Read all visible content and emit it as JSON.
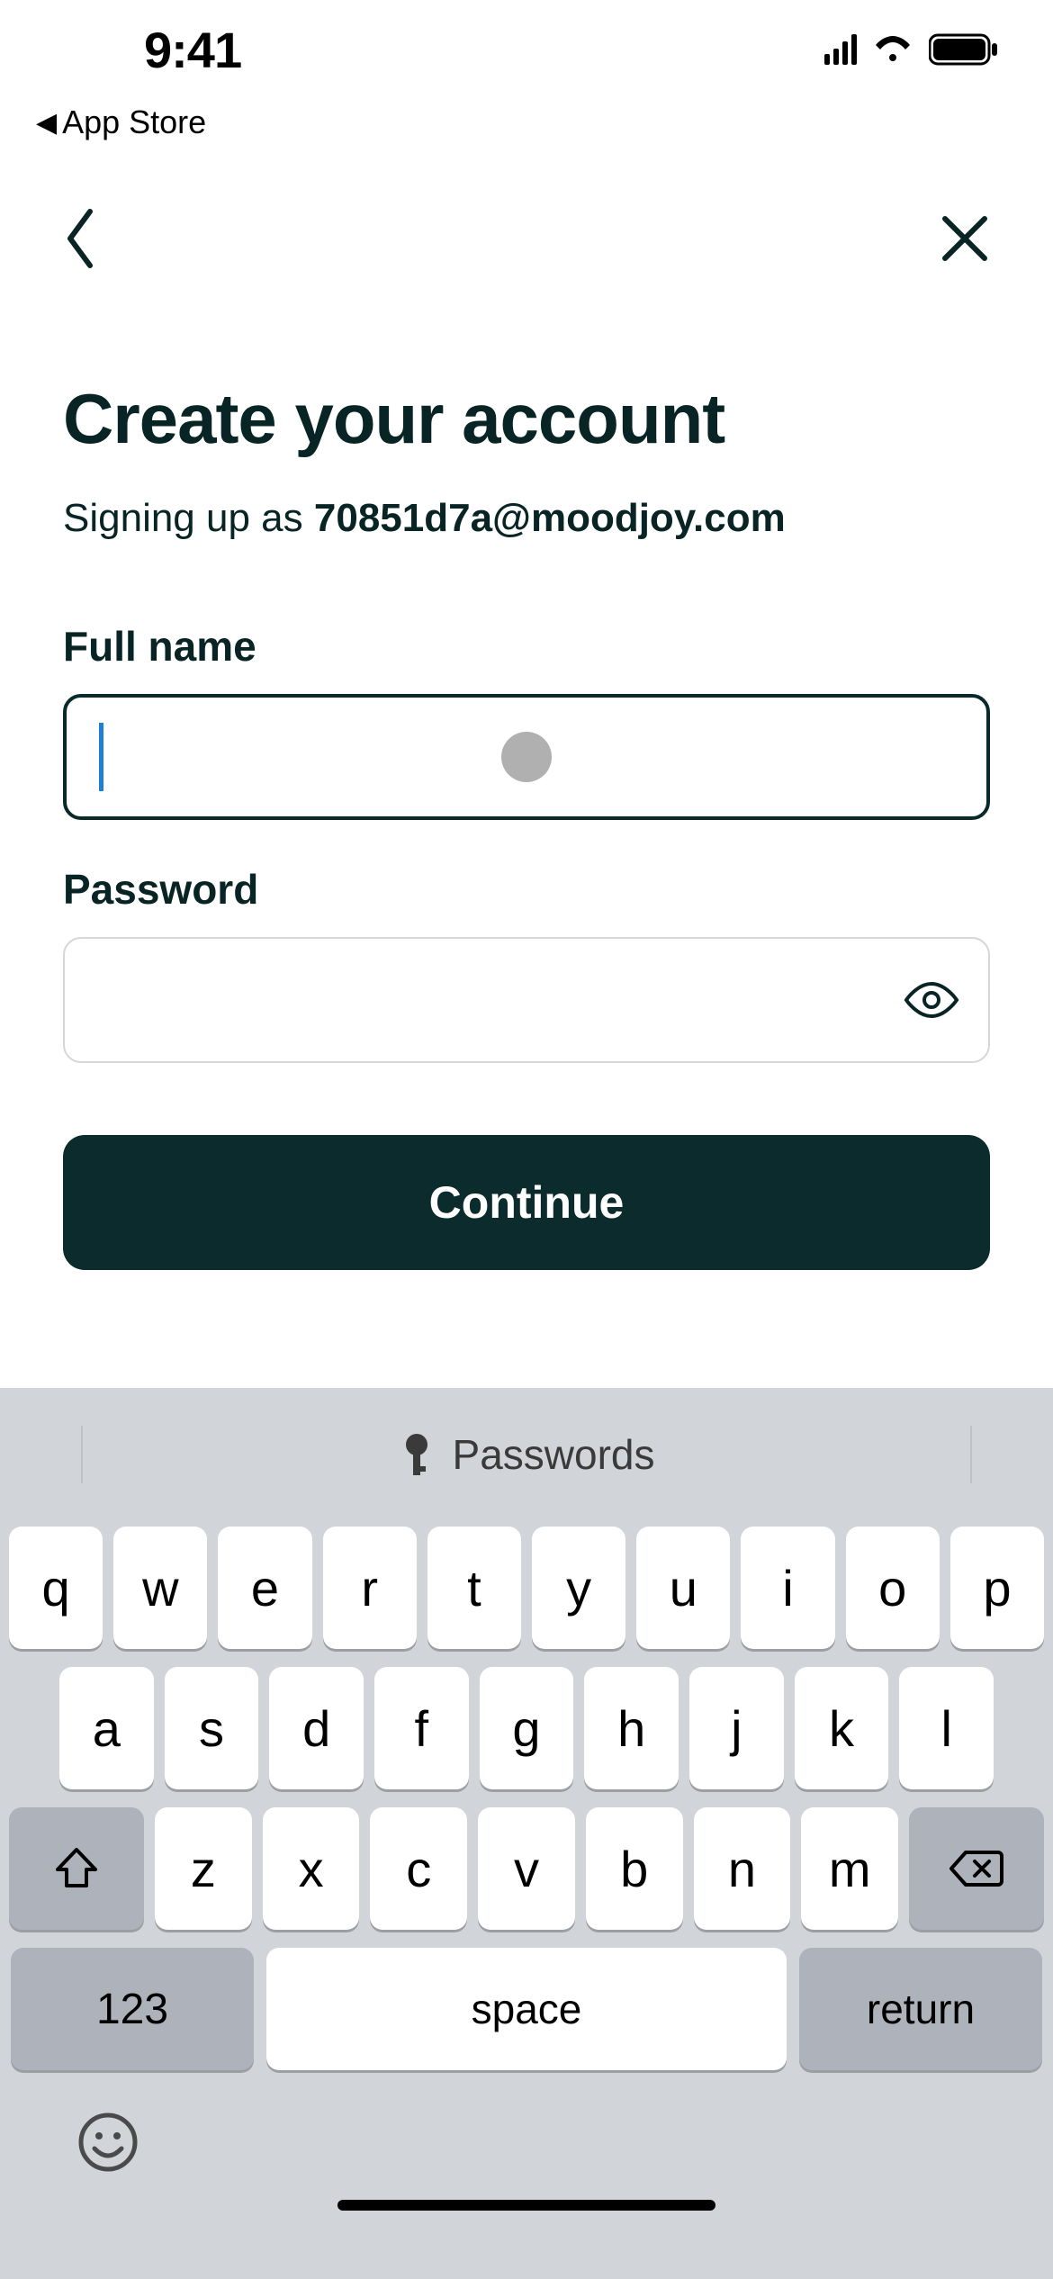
{
  "status": {
    "time": "9:41",
    "back_app_label": "App Store"
  },
  "nav": {
    "back_icon": "chevron-left",
    "close_icon": "x"
  },
  "page": {
    "title": "Create your account",
    "subtitle_prefix": "Signing up as ",
    "email": "70851d7a@moodjoy.com"
  },
  "form": {
    "fullname_label": "Full name",
    "fullname_value": "",
    "password_label": "Password",
    "password_value": "",
    "continue_label": "Continue"
  },
  "keyboard": {
    "suggestion_label": "Passwords",
    "row1": [
      "q",
      "w",
      "e",
      "r",
      "t",
      "y",
      "u",
      "i",
      "o",
      "p"
    ],
    "row2": [
      "a",
      "s",
      "d",
      "f",
      "g",
      "h",
      "j",
      "k",
      "l"
    ],
    "row3": [
      "z",
      "x",
      "c",
      "v",
      "b",
      "n",
      "m"
    ],
    "numbers_label": "123",
    "space_label": "space",
    "return_label": "return"
  }
}
